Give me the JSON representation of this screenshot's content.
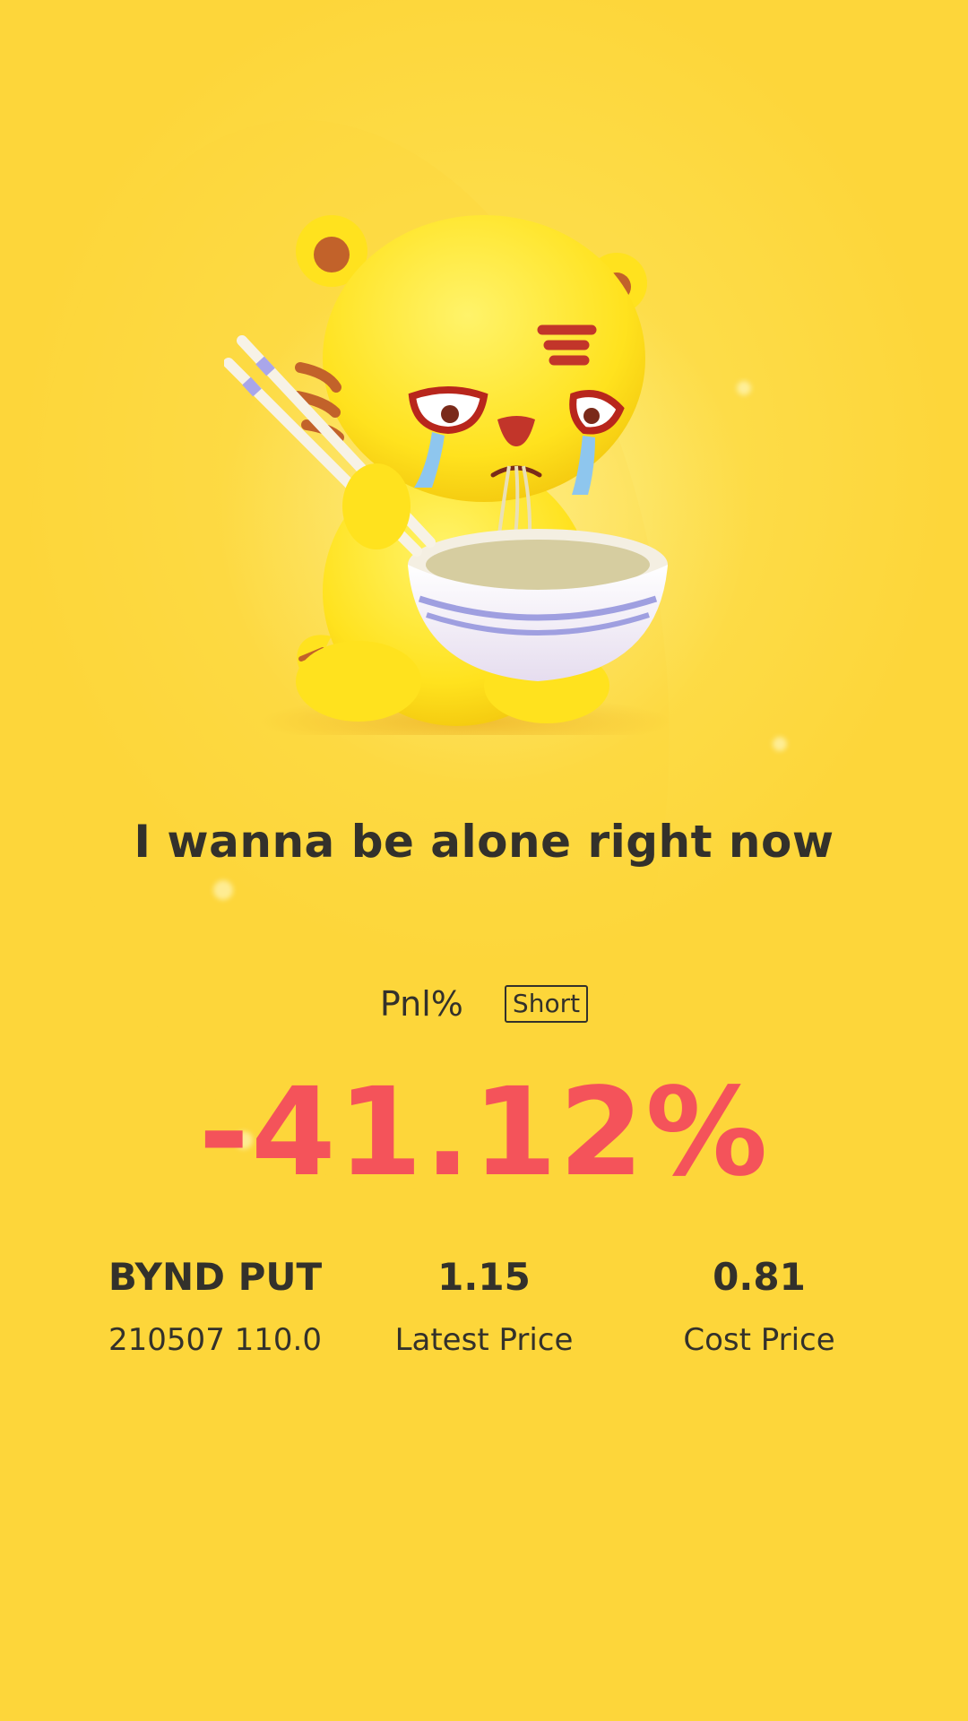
{
  "headline": "I wanna be alone right now",
  "pnl": {
    "label": "Pnl%",
    "badge": "Short",
    "value": "-41.12%",
    "value_color": "#f4535a"
  },
  "stats": [
    {
      "main": "BYND PUT",
      "sub": "210507 110.0"
    },
    {
      "main": "1.15",
      "sub": "Latest Price"
    },
    {
      "main": "0.81",
      "sub": "Cost Price"
    }
  ],
  "mascot": {
    "icon": "crying-tiger-eating-noodles-icon"
  },
  "colors": {
    "background": "#fdd83f",
    "text": "#33312b",
    "loss": "#f4535a"
  }
}
